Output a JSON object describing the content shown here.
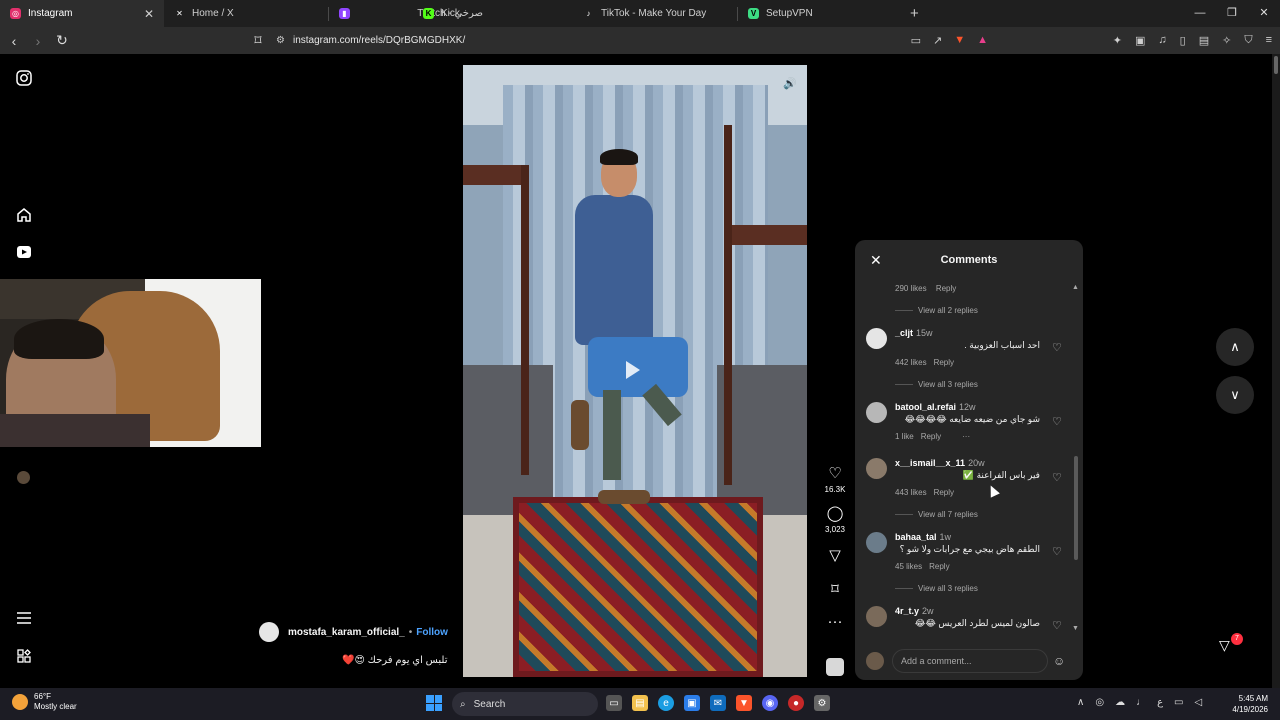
{
  "browser": {
    "tabs": [
      {
        "label": "Instagram",
        "active": true,
        "icon": "instagram-icon",
        "color": "#e1306c"
      },
      {
        "label": "Home / X",
        "active": false,
        "icon": "x-icon",
        "color": "#ffffff"
      },
      {
        "label": "Twitch - صرخي",
        "active": false,
        "icon": "twitch-icon",
        "color": "#9146ff"
      },
      {
        "label": "Kick",
        "active": false,
        "icon": "kick-icon",
        "color": "#53fc18"
      },
      {
        "label": "TikTok - Make Your Day",
        "active": false,
        "icon": "tiktok-icon",
        "color": "#ffffff"
      },
      {
        "label": "SetupVPN",
        "active": false,
        "icon": "vpn-icon",
        "color": "#3ddc84"
      }
    ],
    "new_tab": "+",
    "url": "instagram.com/reels/DQrBGMGDHXK/"
  },
  "reel": {
    "author": "mostafa_karam_official_",
    "follow_label": "Follow",
    "separator": "•",
    "caption": "تلبس اي يوم فرحك 😍❤️",
    "likes": "16.3K",
    "comments": "3,023"
  },
  "comments_panel": {
    "title": "Comments",
    "top_meta": {
      "likes": "290 likes",
      "reply": "Reply"
    },
    "top_view_replies": "View all 2 replies",
    "items": [
      {
        "user": "_cljt",
        "time": "15w",
        "text": "احد اسباب العزوبية .",
        "likes": "442 likes",
        "reply": "Reply",
        "view_replies": "View all 3 replies"
      },
      {
        "user": "batool_al.refai",
        "time": "12w",
        "text": "شو جاي من ضيعه ضايعه 😂😂😂😂",
        "likes": "1 like",
        "reply": "Reply",
        "more": "···",
        "view_replies": ""
      },
      {
        "user": "x__ismail__x_11",
        "time": "20w",
        "text": "فير باس الفراعنة ✅",
        "likes": "443 likes",
        "reply": "Reply",
        "view_replies": "View all 7 replies"
      },
      {
        "user": "bahaa_tal",
        "time": "1w",
        "text": "الطقم هاض بيجي مع جرابات ولا شو ؟",
        "likes": "45 likes",
        "reply": "Reply",
        "view_replies": "View all 3 replies"
      },
      {
        "user": "4r_t.y",
        "time": "2w",
        "text": "صالون لميس لطرد العريس 😂😂",
        "likes": "",
        "reply": "",
        "view_replies": ""
      }
    ],
    "input_placeholder": "Add a comment..."
  },
  "notifications_badge": "7",
  "taskbar": {
    "temperature": "66°F",
    "condition": "Mostly clear",
    "search_label": "Search",
    "time": "5:45 AM",
    "date": "4/19/2026"
  }
}
